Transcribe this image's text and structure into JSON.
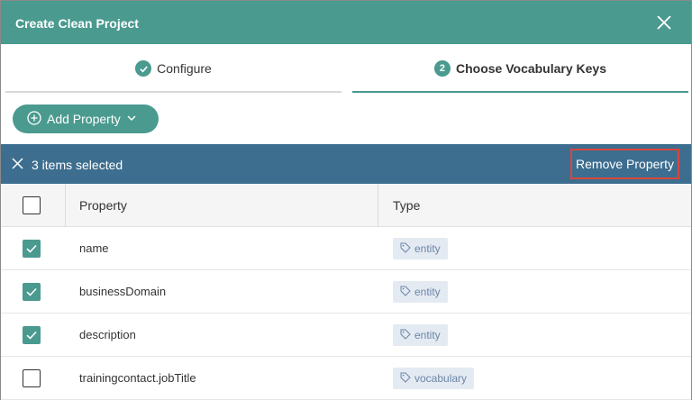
{
  "dialog": {
    "title": "Create Clean Project"
  },
  "steps": [
    {
      "icon": "check-icon",
      "badge": "",
      "label": "Configure"
    },
    {
      "icon": "",
      "badge": "2",
      "label": "Choose Vocabulary Keys"
    }
  ],
  "toolbar": {
    "add_label": "Add Property"
  },
  "selection": {
    "text": "3 items selected",
    "remove_label": "Remove Property"
  },
  "table": {
    "columns": [
      "Property",
      "Type"
    ],
    "rows": [
      {
        "checked": true,
        "property": "name",
        "type": "entity"
      },
      {
        "checked": true,
        "property": "businessDomain",
        "type": "entity"
      },
      {
        "checked": true,
        "property": "description",
        "type": "entity"
      },
      {
        "checked": false,
        "property": "trainingcontact.jobTitle",
        "type": "vocabulary"
      }
    ]
  },
  "colors": {
    "accent": "#4a9a8f",
    "selection_bar": "#3d6e8f",
    "highlight": "#d9463c",
    "tag_bg": "#e4eaf2",
    "tag_text": "#6b86a8"
  }
}
